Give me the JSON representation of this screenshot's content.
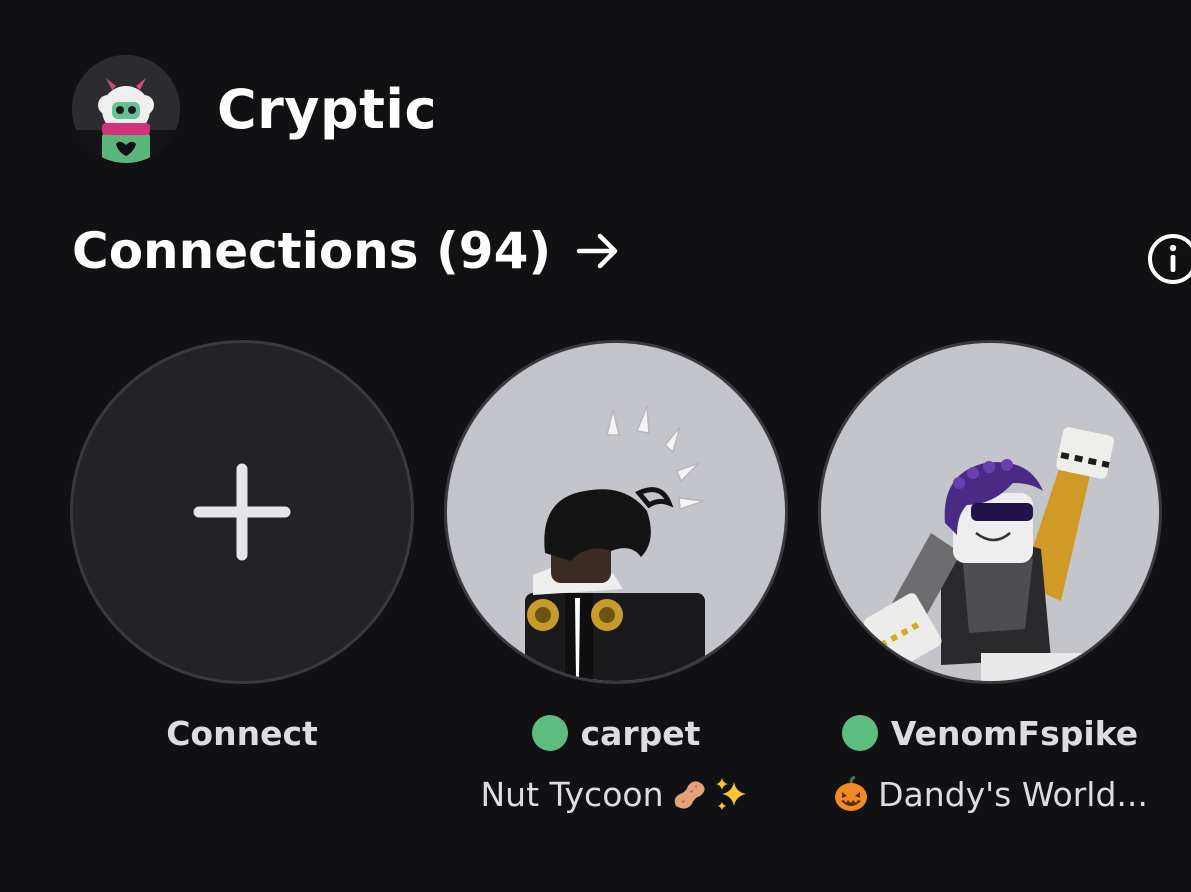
{
  "profile": {
    "name": "Cryptic"
  },
  "connections": {
    "title": "Connections (94)"
  },
  "tiles": [
    {
      "label": "Connect"
    },
    {
      "name": "carpet",
      "status": "Nut Tycoon",
      "status_emojis": [
        "peanut-emoji",
        "sparkles-emoji"
      ],
      "online": true
    },
    {
      "name": "VenomFspike",
      "status": "Dandy's World...",
      "status_emojis": [
        "jack-o-lantern-emoji"
      ],
      "online": true
    }
  ],
  "colors": {
    "background": "#111113",
    "online": "#5dbd80",
    "tile_bg": "#232327",
    "avatar_bg": "#c4c5cb"
  }
}
